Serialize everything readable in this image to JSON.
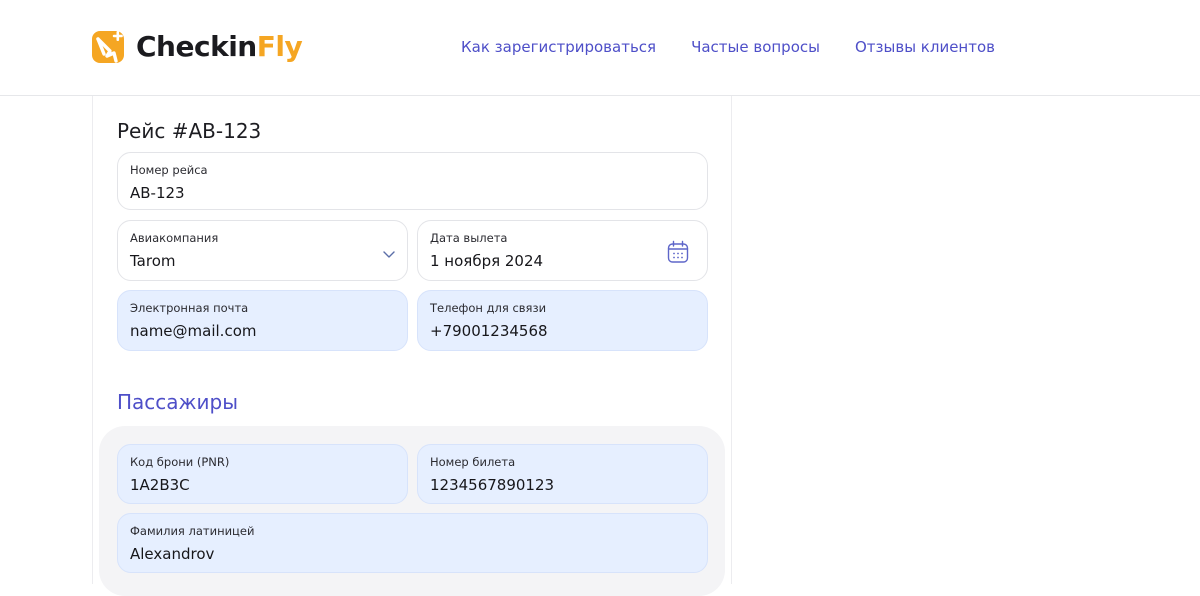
{
  "header": {
    "logo_part1": "Checkin",
    "logo_part2": "Fly",
    "nav": [
      "Как зарегистрироваться",
      "Частые вопросы",
      "Отзывы клиентов"
    ]
  },
  "form": {
    "title": "Рейс #AB-123",
    "flight_number": {
      "label": "Номер рейса",
      "value": "AB-123"
    },
    "airline": {
      "label": "Авиакомпания",
      "value": "Tarom"
    },
    "departure_date": {
      "label": "Дата вылета",
      "value": "1 ноября 2024"
    },
    "email": {
      "label": "Электронная почта",
      "value": "name@mail.com"
    },
    "phone": {
      "label": "Телефон для связи",
      "value": "+79001234568"
    }
  },
  "passengers": {
    "title": "Пассажиры",
    "pnr": {
      "label": "Код брони (PNR)",
      "value": "1A2B3C"
    },
    "ticket": {
      "label": "Номер билета",
      "value": "1234567890123"
    },
    "last_name": {
      "label": "Фамилия латиницей",
      "value": "Alexandrov"
    }
  },
  "colors": {
    "brand_orange": "#f5a623",
    "accent_blue": "#4e4fc8",
    "filled_field_bg": "#e6efff"
  },
  "icons": {
    "logo": "plane-plus-logo-icon",
    "airline_dropdown": "chevron-down-icon",
    "date_picker": "calendar-icon"
  }
}
